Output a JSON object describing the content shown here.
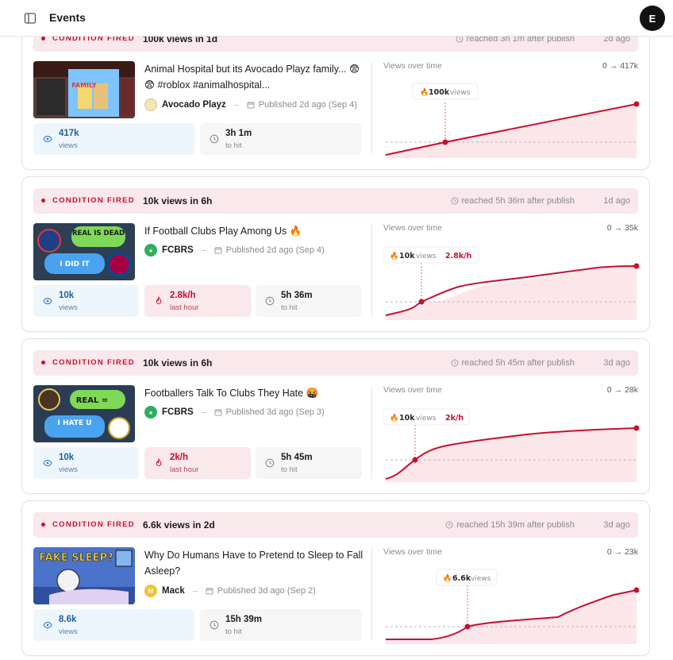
{
  "header": {
    "title": "Events",
    "avatar_initial": "E"
  },
  "events": [
    {
      "banner_label": "CONDITION FIRED",
      "condition": "100k views in 1d",
      "reached": "reached 3h 1m after publish",
      "ago": "2d ago",
      "video_title": "Animal Hospital but its Avocado Playz family... 😨😨 #roblox #animalhospital...",
      "channel": "Avocado Playz",
      "published": "Published 2d ago (Sep 4)",
      "stats": [
        {
          "kind": "views",
          "value": "417k",
          "sub": "views"
        },
        {
          "kind": "time",
          "value": "3h 1m",
          "sub": "to hit"
        }
      ],
      "chart": {
        "label": "Views over time",
        "range": "0 → 417k",
        "badge_views": "100k",
        "badge_views_suffix": "views",
        "badge_rate": ""
      }
    },
    {
      "banner_label": "CONDITION FIRED",
      "condition": "10k views in 6h",
      "reached": "reached 5h 36m after publish",
      "ago": "1d ago",
      "video_title": "If Football Clubs Play Among Us 🔥",
      "channel": "FCBRS",
      "published": "Published 2d ago (Sep 4)",
      "stats": [
        {
          "kind": "views",
          "value": "10k",
          "sub": "views"
        },
        {
          "kind": "rate",
          "value": "2.8k/h",
          "sub": "last hour"
        },
        {
          "kind": "time",
          "value": "5h 36m",
          "sub": "to hit"
        }
      ],
      "chart": {
        "label": "Views over time",
        "range": "0 → 35k",
        "badge_views": "10k",
        "badge_views_suffix": "views",
        "badge_rate": "2.8k/h"
      }
    },
    {
      "banner_label": "CONDITION FIRED",
      "condition": "10k views in 6h",
      "reached": "reached 5h 45m after publish",
      "ago": "3d ago",
      "video_title": "Footballers Talk To Clubs They Hate 🤬",
      "channel": "FCBRS",
      "published": "Published 3d ago (Sep 3)",
      "stats": [
        {
          "kind": "views",
          "value": "10k",
          "sub": "views"
        },
        {
          "kind": "rate",
          "value": "2k/h",
          "sub": "last hour"
        },
        {
          "kind": "time",
          "value": "5h 45m",
          "sub": "to hit"
        }
      ],
      "chart": {
        "label": "Views over time",
        "range": "0 → 28k",
        "badge_views": "10k",
        "badge_views_suffix": "views",
        "badge_rate": "2k/h"
      }
    },
    {
      "banner_label": "CONDITION FIRED",
      "condition": "6.6k views in 2d",
      "reached": "reached 15h 39m after publish",
      "ago": "3d ago",
      "video_title": "Why Do Humans Have to Pretend to Sleep to Fall Asleep?",
      "channel": "Mack",
      "published": "Published 3d ago (Sep 2)",
      "stats": [
        {
          "kind": "views",
          "value": "8.6k",
          "sub": "views"
        },
        {
          "kind": "time",
          "value": "15h 39m",
          "sub": "to hit"
        }
      ],
      "chart": {
        "label": "Views over time",
        "range": "0 → 23k",
        "badge_views": "6.6k",
        "badge_views_suffix": "views",
        "badge_rate": ""
      }
    }
  ],
  "thumbnail_text": {
    "t0": "FAMILY",
    "t1a": "REAL IS DEAD",
    "t1b": "I DID IT",
    "t2a": "REAL =",
    "t2b": "I HATE U",
    "t3": "FAKE SLEEP?"
  },
  "colors": {
    "accent": "#c8102e",
    "banner_bg": "#f9e8ec",
    "views_bg": "#eef6fd"
  }
}
